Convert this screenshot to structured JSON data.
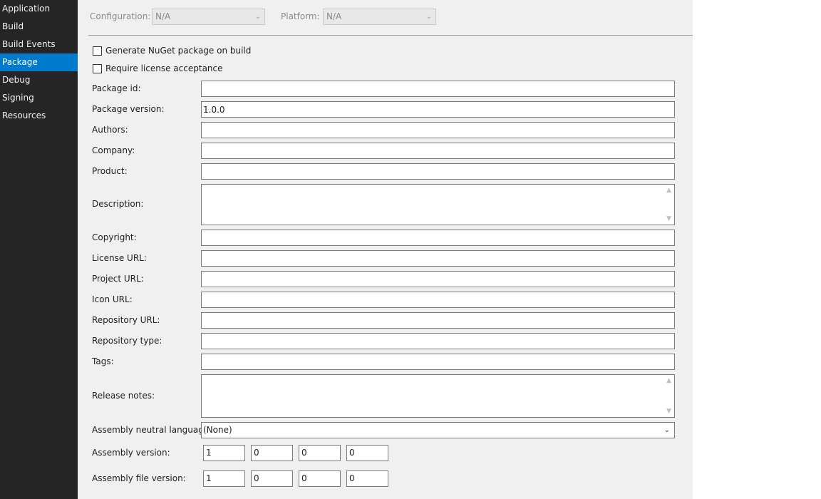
{
  "sidebar": {
    "items": [
      {
        "label": "Application",
        "active": false
      },
      {
        "label": "Build",
        "active": false
      },
      {
        "label": "Build Events",
        "active": false
      },
      {
        "label": "Package",
        "active": true
      },
      {
        "label": "Debug",
        "active": false
      },
      {
        "label": "Signing",
        "active": false
      },
      {
        "label": "Resources",
        "active": false
      }
    ]
  },
  "config": {
    "configuration_label": "Configuration:",
    "configuration_value": "N/A",
    "platform_label": "Platform:",
    "platform_value": "N/A"
  },
  "checkboxes": {
    "generate_nuget": {
      "label": "Generate NuGet package on build",
      "checked": false
    },
    "require_license": {
      "label": "Require license acceptance",
      "checked": false
    }
  },
  "fields": {
    "package_id": {
      "label": "Package id:",
      "value": ""
    },
    "package_version": {
      "label": "Package version:",
      "value": "1.0.0"
    },
    "authors": {
      "label": "Authors:",
      "value": ""
    },
    "company": {
      "label": "Company:",
      "value": ""
    },
    "product": {
      "label": "Product:",
      "value": ""
    },
    "description": {
      "label": "Description:",
      "value": ""
    },
    "copyright": {
      "label": "Copyright:",
      "value": ""
    },
    "license_url": {
      "label": "License URL:",
      "value": ""
    },
    "project_url": {
      "label": "Project URL:",
      "value": ""
    },
    "icon_url": {
      "label": "Icon URL:",
      "value": ""
    },
    "repository_url": {
      "label": "Repository URL:",
      "value": ""
    },
    "repository_type": {
      "label": "Repository type:",
      "value": ""
    },
    "tags": {
      "label": "Tags:",
      "value": ""
    },
    "release_notes": {
      "label": "Release notes:",
      "value": ""
    }
  },
  "assembly": {
    "neutral_language_label": "Assembly neutral language:",
    "neutral_language_value": "(None)",
    "version_label": "Assembly version:",
    "version": [
      "1",
      "0",
      "0",
      "0"
    ],
    "file_version_label": "Assembly file version:",
    "file_version": [
      "1",
      "0",
      "0",
      "0"
    ]
  },
  "colors": {
    "sidebar_bg": "#252526",
    "active_item": "#007acc",
    "content_bg": "#f0f0f0"
  }
}
